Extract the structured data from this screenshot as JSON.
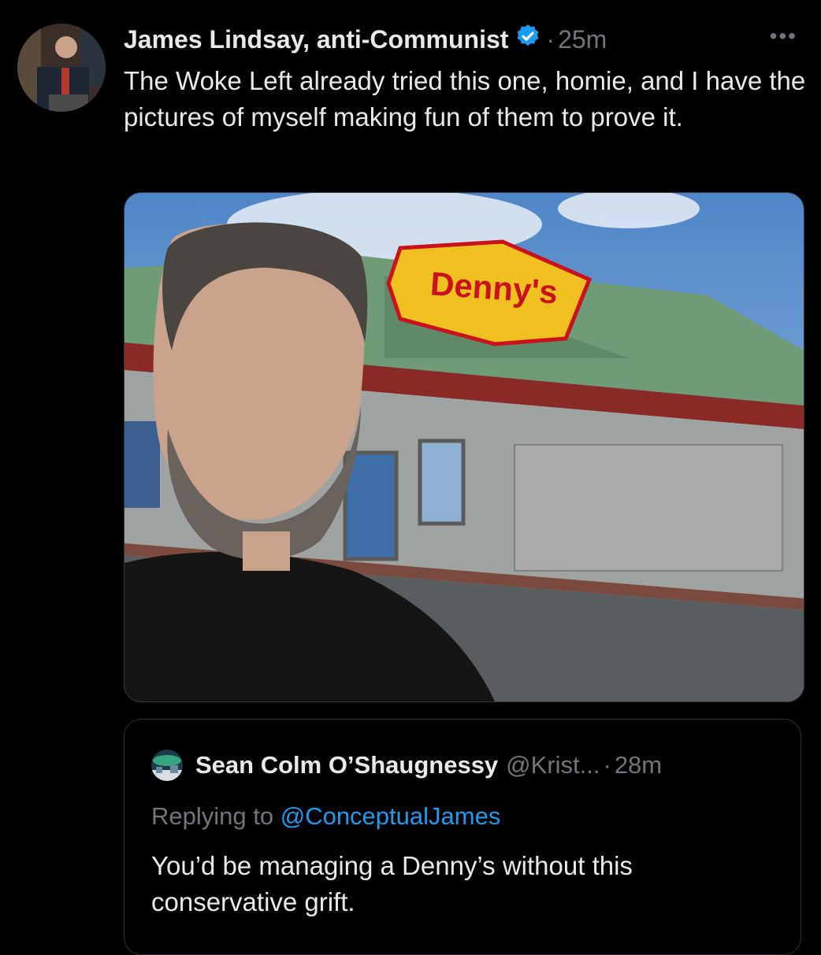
{
  "tweet": {
    "author_name": "James Lindsay, anti-Communist",
    "verified_icon": "verified-badge-icon",
    "separator": "·",
    "time": "25m",
    "more_icon": "more-options-icon",
    "more_glyph": "•••",
    "text": "The Woke Left already tried this one, homie, and I have the pictures of myself making fun of them to prove it.",
    "image": {
      "description_icon": "selfie-photo",
      "sign_text": "Denny's"
    }
  },
  "quoted_tweet": {
    "author_name": "Sean Colm O’Shaugnessy",
    "handle": "@Krist...",
    "separator": "·",
    "time": "28m",
    "replying_prefix": "Replying to",
    "replying_handle": "@ConceptualJames",
    "text": "You’d be managing a Denny’s without this conservative grift."
  },
  "colors": {
    "background": "#000000",
    "text": "#e7e9ea",
    "muted": "#71767b",
    "link": "#1d9bf0",
    "verified": "#1d9bf0"
  }
}
